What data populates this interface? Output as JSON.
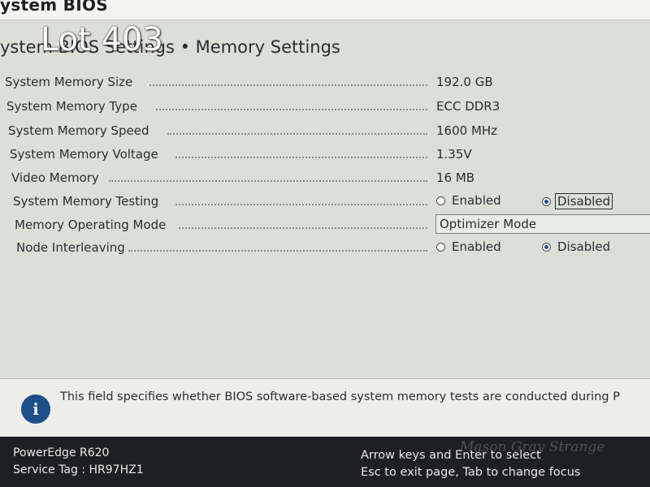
{
  "app_title": "ystem BIOS",
  "page_title": "ystem BIOS Settings • Memory Settings",
  "overlay_label": "Lot 403",
  "settings": [
    {
      "label": "System Memory Size",
      "value": "192.0 GB"
    },
    {
      "label": "System Memory Type",
      "value": "ECC DDR3"
    },
    {
      "label": "System Memory Speed",
      "value": "1600 MHz"
    },
    {
      "label": "System Memory Voltage",
      "value": "1.35V"
    },
    {
      "label": "Video Memory",
      "value": "16 MB"
    },
    {
      "label": "System Memory Testing",
      "options": [
        "Enabled",
        "Disabled"
      ],
      "selected": "Disabled"
    },
    {
      "label": "Memory Operating Mode",
      "value": "Optimizer Mode"
    },
    {
      "label": "Node Interleaving",
      "options": [
        "Enabled",
        "Disabled"
      ],
      "selected": "Disabled"
    }
  ],
  "help_text": "This field specifies whether BIOS software-based system memory tests are conducted during P",
  "footer": {
    "model": "PowerEdge R620",
    "service_tag": "Service Tag : HR97HZ1",
    "hint_select": "Arrow keys and Enter to select",
    "hint_exit": "Esc to exit page, Tab to change focus"
  },
  "watermark": "Mason Gray Strange",
  "icons": {
    "info": "info-icon",
    "radio": "radio-icon"
  },
  "colors": {
    "background": "#dcdfd8",
    "footer": "#1e1f22",
    "info_icon": "#1c4e8a"
  }
}
